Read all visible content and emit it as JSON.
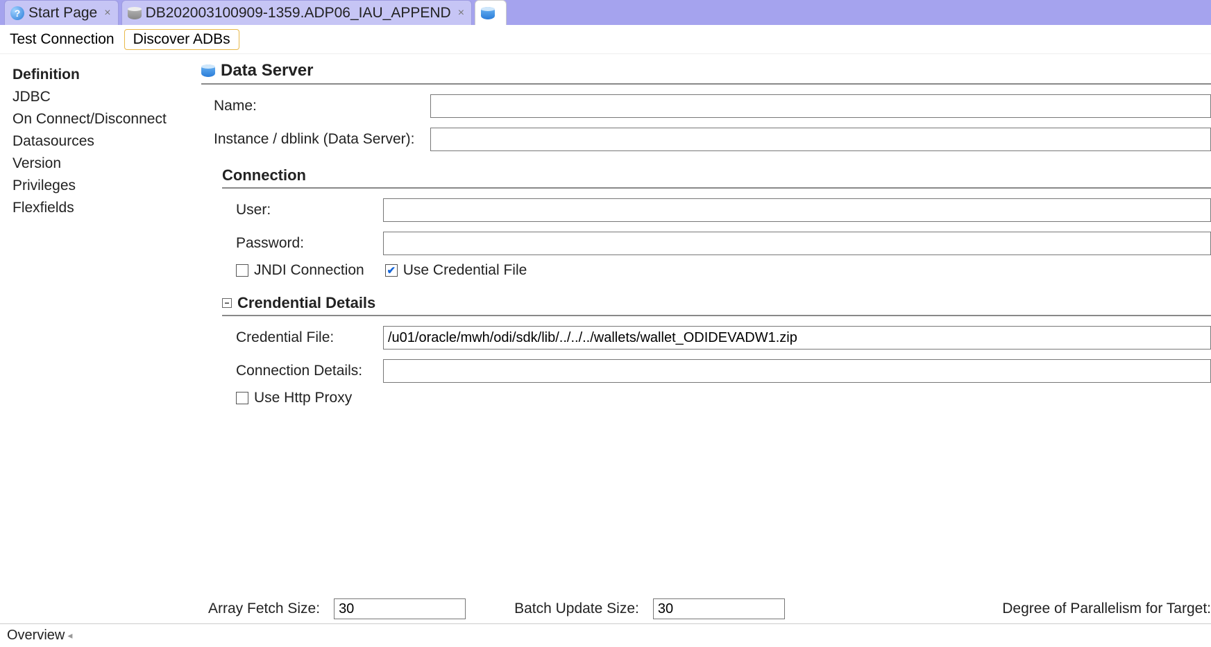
{
  "tabs": [
    {
      "label": "Start Page",
      "icon": "help"
    },
    {
      "label": "DB202003100909-1359.ADP06_IAU_APPEND",
      "icon": "db-gray"
    },
    {
      "label": "",
      "icon": "db"
    }
  ],
  "toolbar": {
    "test_connection": "Test Connection",
    "discover_adbs": "Discover ADBs"
  },
  "sidebar": {
    "items": [
      "Definition",
      "JDBC",
      "On Connect/Disconnect",
      "Datasources",
      "Version",
      "Privileges",
      "Flexfields"
    ],
    "active_index": 0
  },
  "main": {
    "data_server_title": "Data Server",
    "name_label": "Name:",
    "name_value": "",
    "instance_label": "Instance / dblink (Data Server):",
    "instance_value": "",
    "connection_title": "Connection",
    "user_label": "User:",
    "user_value": "",
    "password_label": "Password:",
    "password_value": "",
    "jndi_label": "JNDI Connection",
    "jndi_checked": false,
    "usecred_label": "Use Credential File",
    "usecred_checked": true,
    "cred_title": "Crendential Details",
    "credfile_label": "Credential File:",
    "credfile_value": "/u01/oracle/mwh/odi/sdk/lib/../../../wallets/wallet_ODIDEVADW1.zip",
    "conndetails_label": "Connection Details:",
    "conndetails_value": "",
    "httpproxy_label": "Use Http Proxy",
    "httpproxy_checked": false,
    "array_fetch_label": "Array Fetch Size:",
    "array_fetch_value": "30",
    "batch_update_label": "Batch Update Size:",
    "batch_update_value": "30",
    "dop_label": "Degree of Parallelism for Target:"
  },
  "statusbar": {
    "overview": "Overview"
  }
}
